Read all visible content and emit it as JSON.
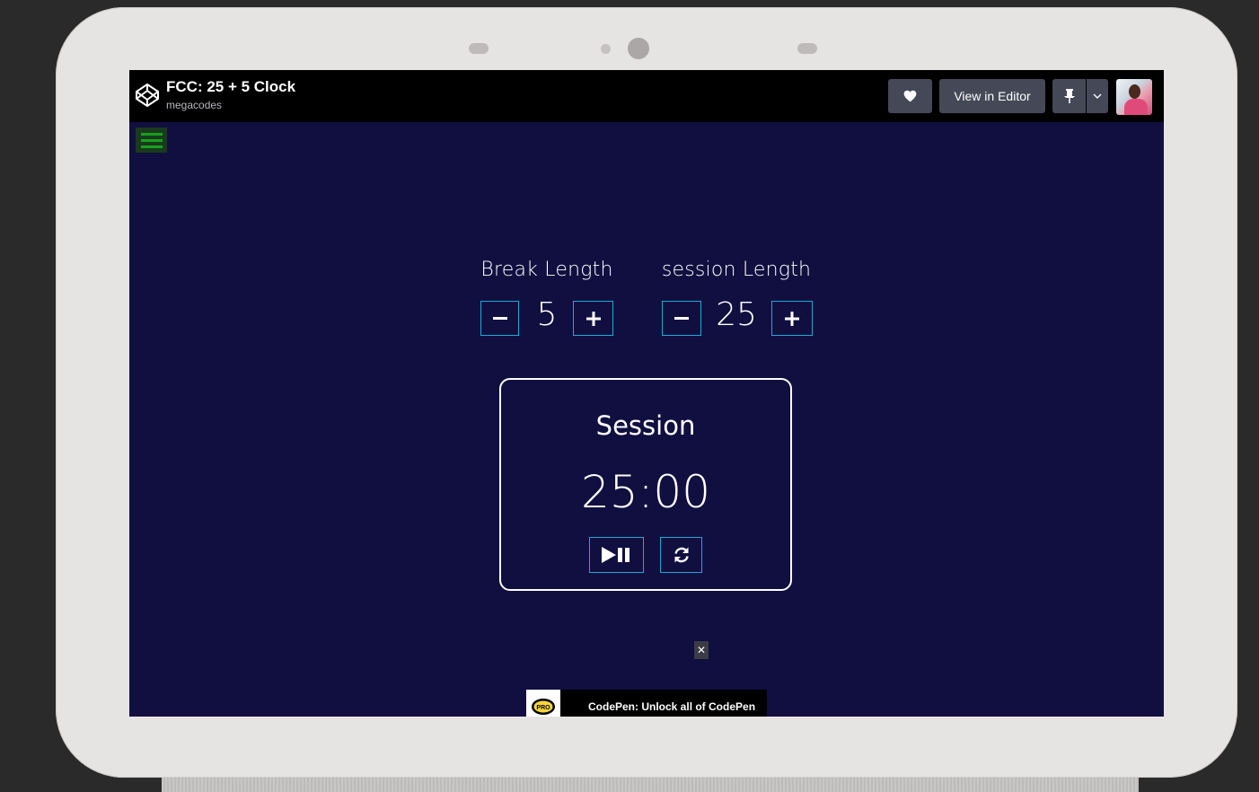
{
  "header": {
    "title": "FCC: 25 + 5 Clock",
    "author": "megacodes",
    "view_editor_label": "View in Editor",
    "logo_icon": "codepen-logo-icon",
    "heart_icon": "heart-icon",
    "pin_icon": "pin-icon",
    "dropdown_icon": "chevron-down-icon"
  },
  "clock": {
    "break_label": "Break Length",
    "break_value": "5",
    "session_label": "session Length",
    "session_value": "25",
    "timer_label": "Session",
    "timer_time": "25:00",
    "decrement_symbol": "−",
    "increment_symbol": "+",
    "play_pause_icon": "play-pause-icon",
    "reset_icon": "refresh-icon"
  },
  "promo": {
    "badge": "PRO",
    "text": "CodePen: Unlock all of CodePen",
    "close": "✕"
  },
  "colors": {
    "background": "#110f40",
    "button_border": "#1fa9d6",
    "topbar": "#000000",
    "topbar_button": "#444857",
    "hamburger": "#17a21c"
  }
}
